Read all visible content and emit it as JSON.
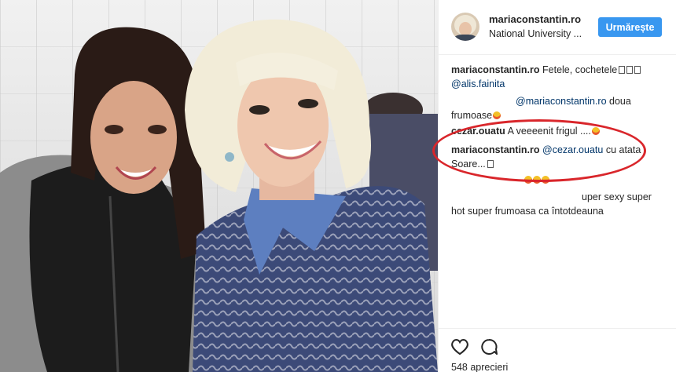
{
  "post": {
    "username": "mariaconstantin.ro",
    "location": "National University ...",
    "follow_label": "Urmărește",
    "likes": "548 aprecieri"
  },
  "comments": [
    {
      "user": "mariaconstantin.ro",
      "text": " Fetele, cochetele",
      "mention": "@alis.fainita"
    },
    {
      "mention": "@mariaconstantin.ro",
      "text": " doua",
      "text2": "frumoase"
    },
    {
      "user": "cezar.ouatu",
      "text": " A veeeenit frigul ...."
    },
    {
      "user": "mariaconstantin.ro",
      "mention": "@cezar.ouatu",
      "text": " cu atata",
      "text2": "Soare..."
    },
    {
      "text": "uper sexy super",
      "text2": "hot super frumoasa ca întotdeauna"
    }
  ],
  "icons": {
    "like": "heart-icon",
    "comment": "comment-icon"
  },
  "colors": {
    "follow_button": "#3897f0",
    "mention": "#003569",
    "highlight_oval": "#d9262b"
  }
}
